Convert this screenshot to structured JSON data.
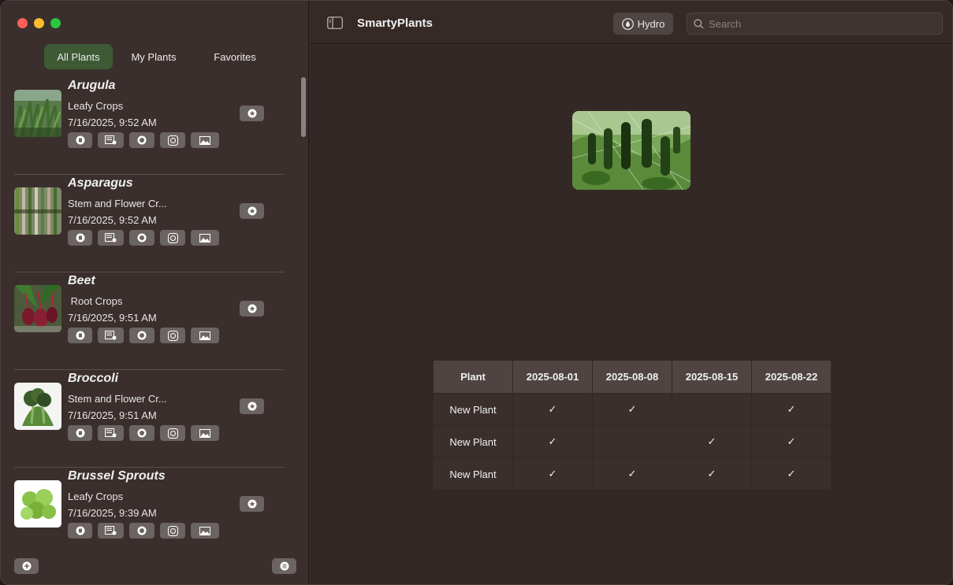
{
  "app": {
    "title": "SmartyPlants"
  },
  "toolbar": {
    "hydro_label": "Hydro",
    "search_placeholder": "Search"
  },
  "tabs": [
    {
      "label": "All Plants",
      "active": true
    },
    {
      "label": "My Plants",
      "active": false
    },
    {
      "label": "Favorites",
      "active": false
    }
  ],
  "plants": [
    {
      "name": "Arugula",
      "category": "Leafy Crops",
      "date": "7/16/2025, 9:52 AM"
    },
    {
      "name": "Asparagus",
      "category": "Stem and Flower Cr...",
      "date": "7/16/2025, 9:52 AM"
    },
    {
      "name": "Beet",
      "category": " Root Crops",
      "date": "7/16/2025, 9:51 AM"
    },
    {
      "name": "Broccoli",
      "category": "Stem and Flower Cr...",
      "date": "7/16/2025, 9:51 AM"
    },
    {
      "name": "Brussel Sprouts",
      "category": "Leafy Crops",
      "date": "7/16/2025, 9:39 AM"
    }
  ],
  "schedule": {
    "headers": [
      "Plant",
      "2025-08-01",
      "2025-08-08",
      "2025-08-15",
      "2025-08-22"
    ],
    "rows": [
      {
        "plant": "New Plant",
        "checks": [
          "✓",
          "✓",
          "",
          "✓"
        ]
      },
      {
        "plant": "New Plant",
        "checks": [
          "✓",
          "",
          "✓",
          "✓"
        ]
      },
      {
        "plant": "New Plant",
        "checks": [
          "✓",
          "✓",
          "✓",
          "✓"
        ]
      }
    ]
  },
  "colors": {
    "accent_active_tab": "#3d5a34",
    "sidebar_bg": "#3a2f2c",
    "content_bg": "#342826"
  }
}
